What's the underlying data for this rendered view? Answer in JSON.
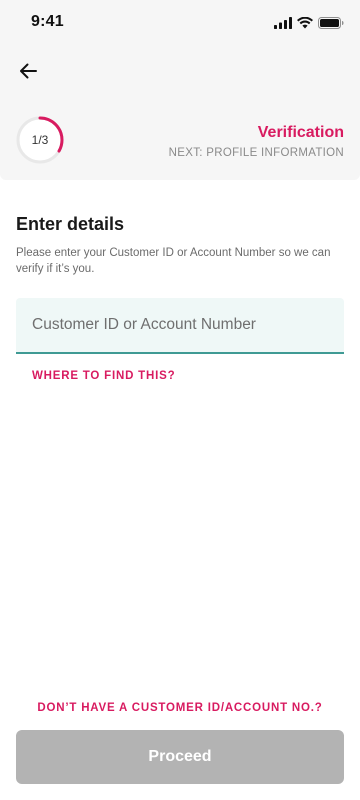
{
  "status_bar": {
    "time": "9:41",
    "icons": [
      "signal-icon",
      "wifi-icon",
      "battery-icon"
    ]
  },
  "header": {
    "back_icon": "arrow-left-icon",
    "progress": {
      "label": "1/3",
      "fraction": 0.3333
    },
    "step_title": "Verification",
    "next_step": "NEXT: PROFILE INFORMATION"
  },
  "main": {
    "title": "Enter details",
    "description": "Please enter your Customer ID or Account Number so we can verify if it’s you.",
    "input": {
      "placeholder": "Customer ID or Account Number",
      "value": ""
    },
    "find_link": "WHERE TO FIND THIS?"
  },
  "footer": {
    "no_id_link": "DON’T HAVE A CUSTOMER ID/ACCOUNT NO.?",
    "proceed_label": "Proceed"
  },
  "colors": {
    "accent": "#d81b60",
    "input_bg": "#eff8f7",
    "input_underline": "#3f9a94",
    "button_disabled": "#b3b3b3",
    "header_bg": "#f6f6f6"
  }
}
